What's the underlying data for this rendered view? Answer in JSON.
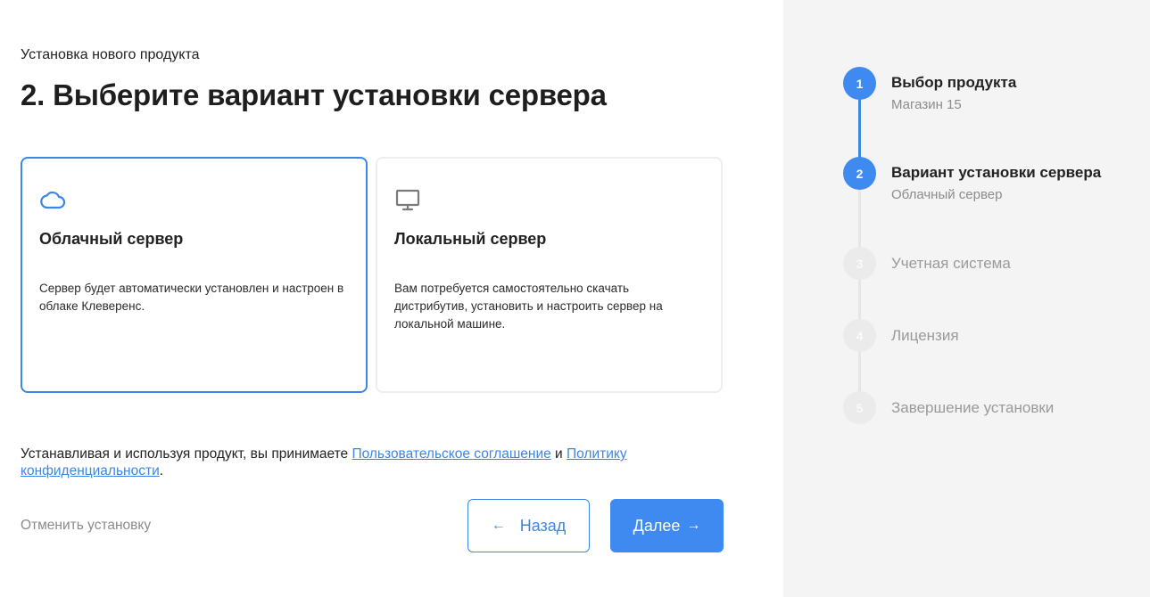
{
  "header": {
    "overline": "Установка нового продукта",
    "title": "2. Выберите вариант установки сервера"
  },
  "options": [
    {
      "icon": "cloud-icon",
      "title": "Облачный сервер",
      "description": "Сервер будет автоматически установлен и настроен в облаке Клеверенс.",
      "selected": true
    },
    {
      "icon": "monitor-icon",
      "title": "Локальный сервер",
      "description": "Вам потребуется самостоятельно скачать дистрибутив, установить и настроить сервер на локальной машине.",
      "selected": false
    }
  ],
  "agreement": {
    "text_before": "Устанавливая и используя продукт, вы принимаете ",
    "link_terms": "Пользовательское соглашение",
    "text_and": " и ",
    "link_privacy": "Политику конфиденциальности",
    "text_after": "."
  },
  "footer": {
    "cancel_label": "Отменить установку",
    "back_label": "Назад",
    "back_arrow": "←",
    "next_label": "Далее",
    "next_arrow": "→"
  },
  "steps": [
    {
      "number": "1",
      "label": "Выбор продукта",
      "sub": "Магазин 15",
      "state": "done"
    },
    {
      "number": "2",
      "label": "Вариант установки сервера",
      "sub": "Облачный сервер",
      "state": "active"
    },
    {
      "number": "3",
      "label": "Учетная система",
      "sub": "",
      "state": "inactive"
    },
    {
      "number": "4",
      "label": "Лицензия",
      "sub": "",
      "state": "inactive"
    },
    {
      "number": "5",
      "label": "Завершение установки",
      "sub": "",
      "state": "inactive"
    }
  ],
  "colors": {
    "accent": "#3e8af0",
    "sidebar_bg": "#f4f4f4",
    "inactive_step": "#ebebeb",
    "muted_text": "#8a8a8a"
  }
}
